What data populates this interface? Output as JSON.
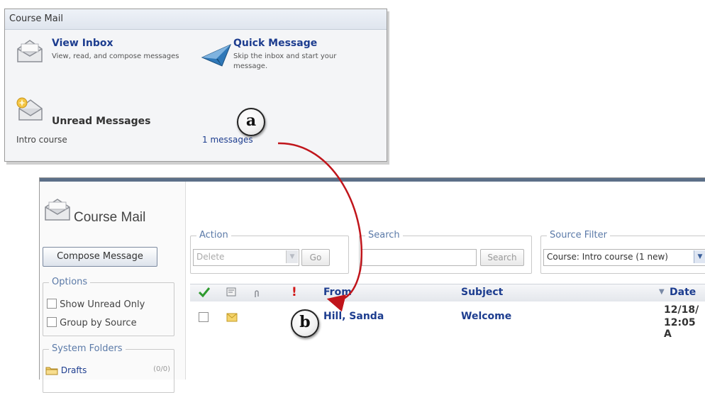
{
  "course_mail_widget": {
    "header": "Course Mail",
    "view_inbox": {
      "title": "View Inbox",
      "description": "View, read, and compose messages"
    },
    "quick_message": {
      "title": "Quick Message",
      "description": "Skip the inbox and start your message."
    },
    "unread_messages": {
      "title": "Unread Messages",
      "course": "Intro course",
      "count_link": "1 messages"
    }
  },
  "callouts": {
    "a": "a",
    "b": "b"
  },
  "course_mail_page": {
    "title": "Course Mail",
    "compose_button": "Compose Message",
    "options": {
      "legend": "Options",
      "show_unread_only": "Show Unread Only",
      "group_by_source": "Group by Source"
    },
    "system_folders": {
      "legend": "System Folders",
      "drafts_label": "Drafts",
      "drafts_count": "(0/0)"
    },
    "action": {
      "legend": "Action",
      "selected": "Delete",
      "go_button": "Go"
    },
    "search": {
      "legend": "Search",
      "value": "",
      "button": "Search"
    },
    "source_filter": {
      "legend": "Source Filter",
      "selected": "Course: Intro course (1 new)"
    },
    "table": {
      "headers": {
        "from": "From",
        "subject": "Subject",
        "date": "Date",
        "date_sort_marker": "▼",
        "priority_marker": "!"
      },
      "rows": [
        {
          "from": "Hill, Sanda",
          "subject": "Welcome",
          "date_line1": "12/18/",
          "date_line2": "12:05 A"
        }
      ]
    }
  },
  "colors": {
    "link_blue": "#1d3d8f",
    "legend_blue": "#5b7aa8",
    "arrow_red": "#c0151b",
    "check_green": "#2e9a2e",
    "priority_red": "#d21818"
  },
  "icons": {
    "view_inbox": "envelope-icon",
    "quick_message": "paper-plane-icon",
    "unread_messages": "new-mail-icon",
    "course_mail_logo": "envelope-icon",
    "drafts": "folder-icon",
    "header_check": "check-icon",
    "header_attachment_type": "message-type-icon",
    "header_attachment": "paperclip-icon",
    "header_priority": "exclamation-icon",
    "row_mail": "unread-envelope-icon"
  }
}
